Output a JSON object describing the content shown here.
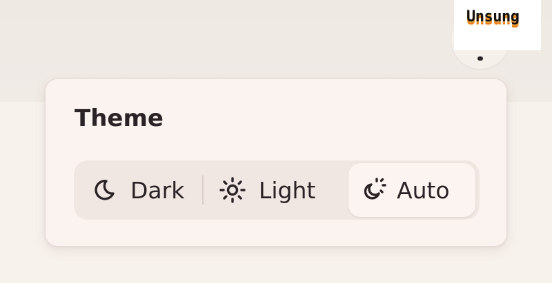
{
  "brand": {
    "name": "Unsung"
  },
  "theme_menu": {
    "title": "Theme",
    "options": [
      {
        "label": "Dark",
        "icon": "moon-icon"
      },
      {
        "label": "Light",
        "icon": "sun-icon"
      },
      {
        "label": "Auto",
        "icon": "auto-theme-icon",
        "selected": true
      }
    ]
  },
  "colors": {
    "text": "#2a2326",
    "popover_bg": "#fbf3f0",
    "segment_track": "#f0e7e2",
    "selected_segment": "#fbf4f1",
    "page_bg": "#f7f1ec"
  }
}
